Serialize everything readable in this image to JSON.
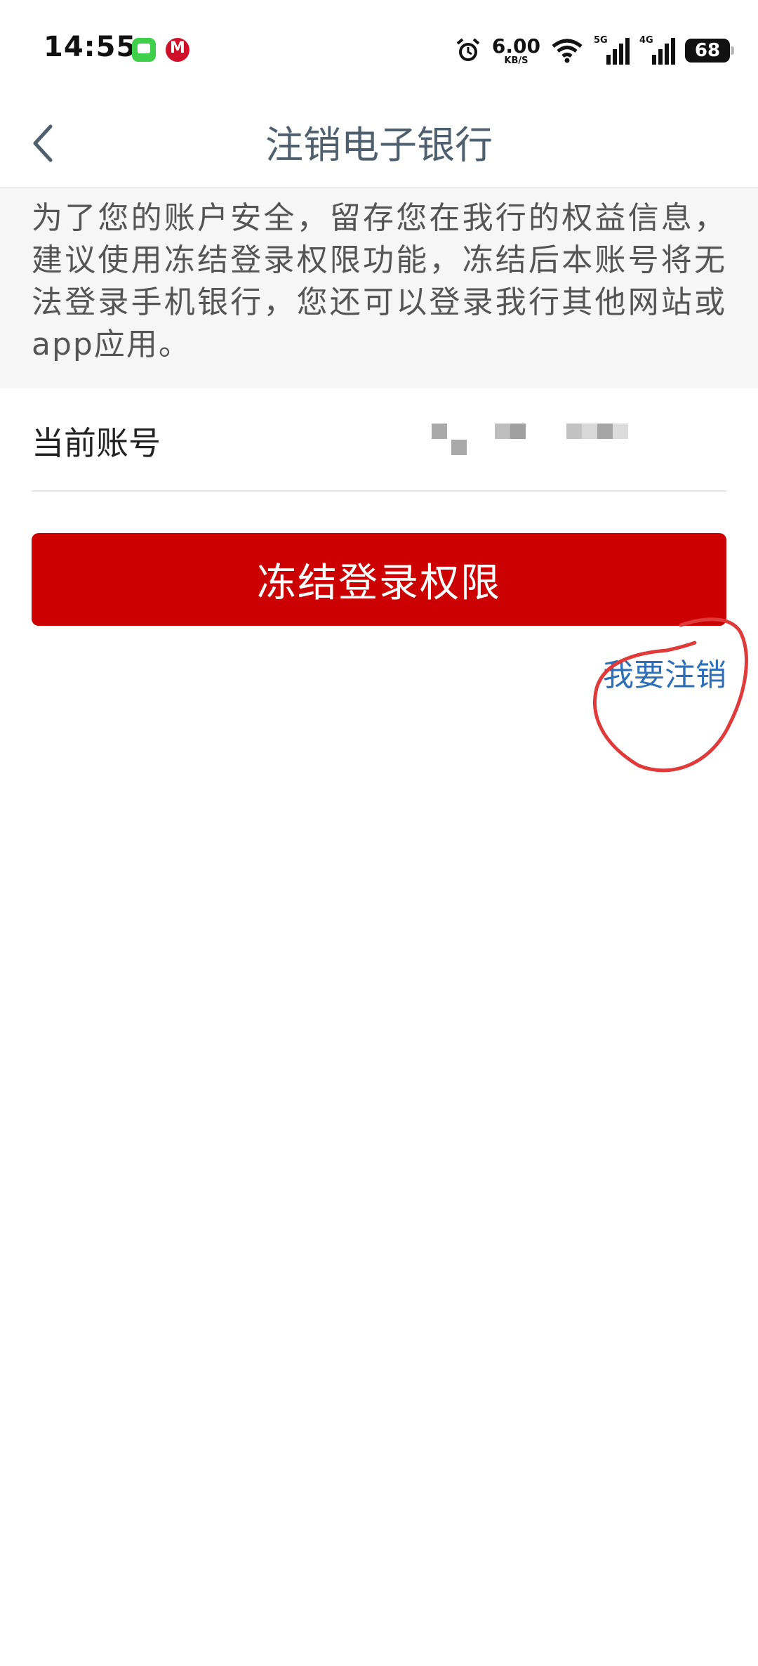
{
  "status_bar": {
    "time": "14:55",
    "net_speed_value": "6.00",
    "net_speed_unit": "KB/S",
    "signal_1_tag": "5G",
    "signal_2_tag": "4G",
    "battery_level": "68",
    "icons": [
      "messages-app-icon",
      "bank-app-icon",
      "alarm-icon",
      "wifi-icon",
      "signal-icon",
      "battery-icon"
    ]
  },
  "nav": {
    "title": "注销电子银行",
    "back_icon": "chevron-left-icon"
  },
  "notice": {
    "text": "为了您的账户安全，留存您在我行的权益信息，建议使用冻结登录权限功能，冻结后本账号将无法登录手机银行，您还可以登录我行其他网站或app应用。"
  },
  "account": {
    "label": "当前账号"
  },
  "actions": {
    "freeze_label": "冻结登录权限",
    "cancel_label": "我要注销"
  },
  "colors": {
    "primary_red": "#cc0000",
    "link_blue": "#2e6fb8",
    "title_gray": "#4f5f6d",
    "notice_bg": "#f6f6f6",
    "annotation_red": "#e03a3a"
  }
}
